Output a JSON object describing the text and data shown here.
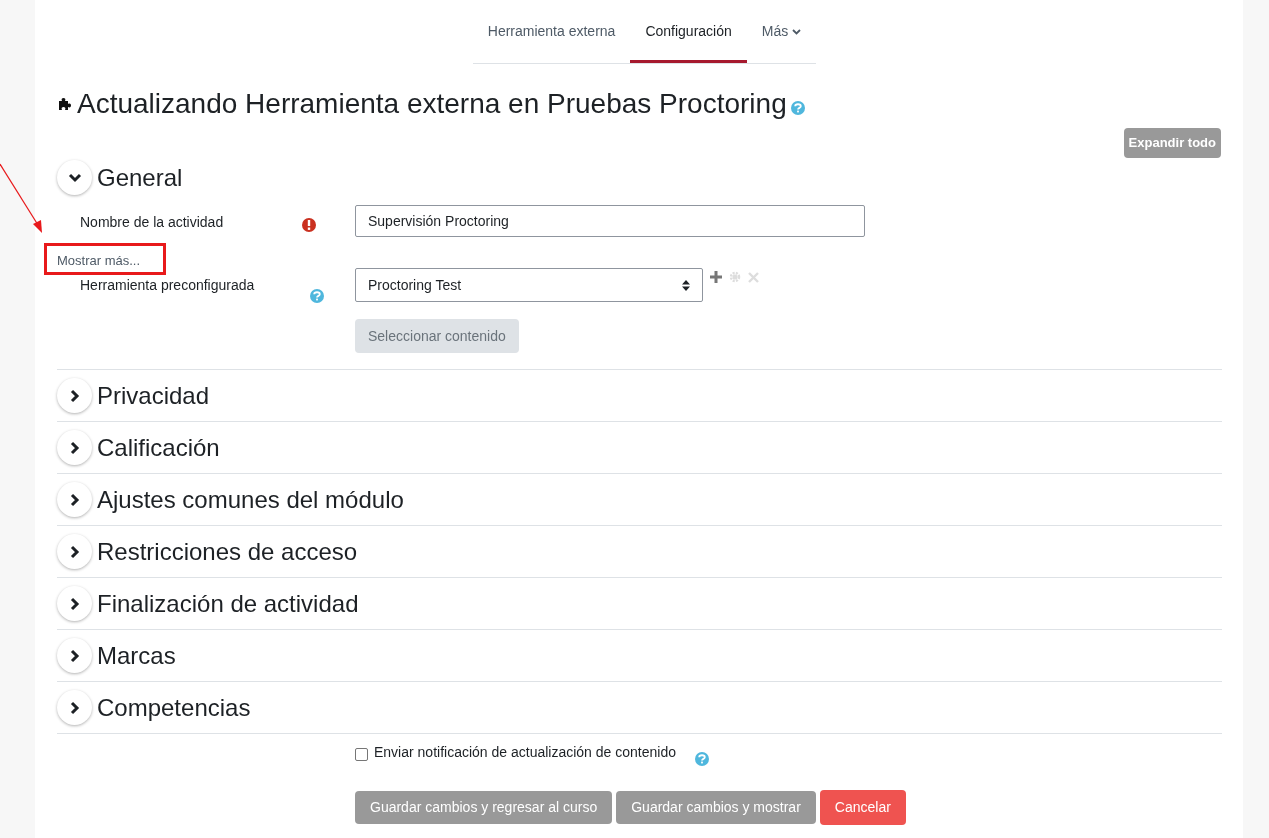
{
  "tabs": [
    {
      "label": "Herramienta externa",
      "selected": false,
      "dropdown": false
    },
    {
      "label": "Configuración",
      "selected": true,
      "dropdown": false
    },
    {
      "label": "Más",
      "selected": false,
      "dropdown": true
    }
  ],
  "title": "Actualizando Herramienta externa en Pruebas Proctoring",
  "expand_all_button": "Expandir todo",
  "sections": [
    {
      "title": "General",
      "expanded": true
    },
    {
      "title": "Privacidad",
      "expanded": false
    },
    {
      "title": "Calificación",
      "expanded": false
    },
    {
      "title": "Ajustes comunes del módulo",
      "expanded": false
    },
    {
      "title": "Restricciones de acceso",
      "expanded": false
    },
    {
      "title": "Finalización de actividad",
      "expanded": false
    },
    {
      "title": "Marcas",
      "expanded": false
    },
    {
      "title": "Competencias",
      "expanded": false
    }
  ],
  "general": {
    "fields": [
      {
        "kind": "text",
        "label": "Nombre de la actividad",
        "required": true,
        "value": "Supervisión Proctoring"
      },
      {
        "kind": "select",
        "label": "Herramienta preconfigurada",
        "required": false,
        "value": "Proctoring Test"
      }
    ],
    "show_more_link": "Mostrar más...",
    "select_content_button": {
      "label": "Seleccionar contenido",
      "disabled": true
    }
  },
  "notify_checkbox": {
    "label": "Enviar notificación de actualización de contenido",
    "checked": false
  },
  "buttons": [
    {
      "label": "Guardar cambios y regresar al curso",
      "kind": "secondary"
    },
    {
      "label": "Guardar cambios y mostrar",
      "kind": "secondary"
    },
    {
      "label": "Cancelar",
      "kind": "danger"
    }
  ]
}
